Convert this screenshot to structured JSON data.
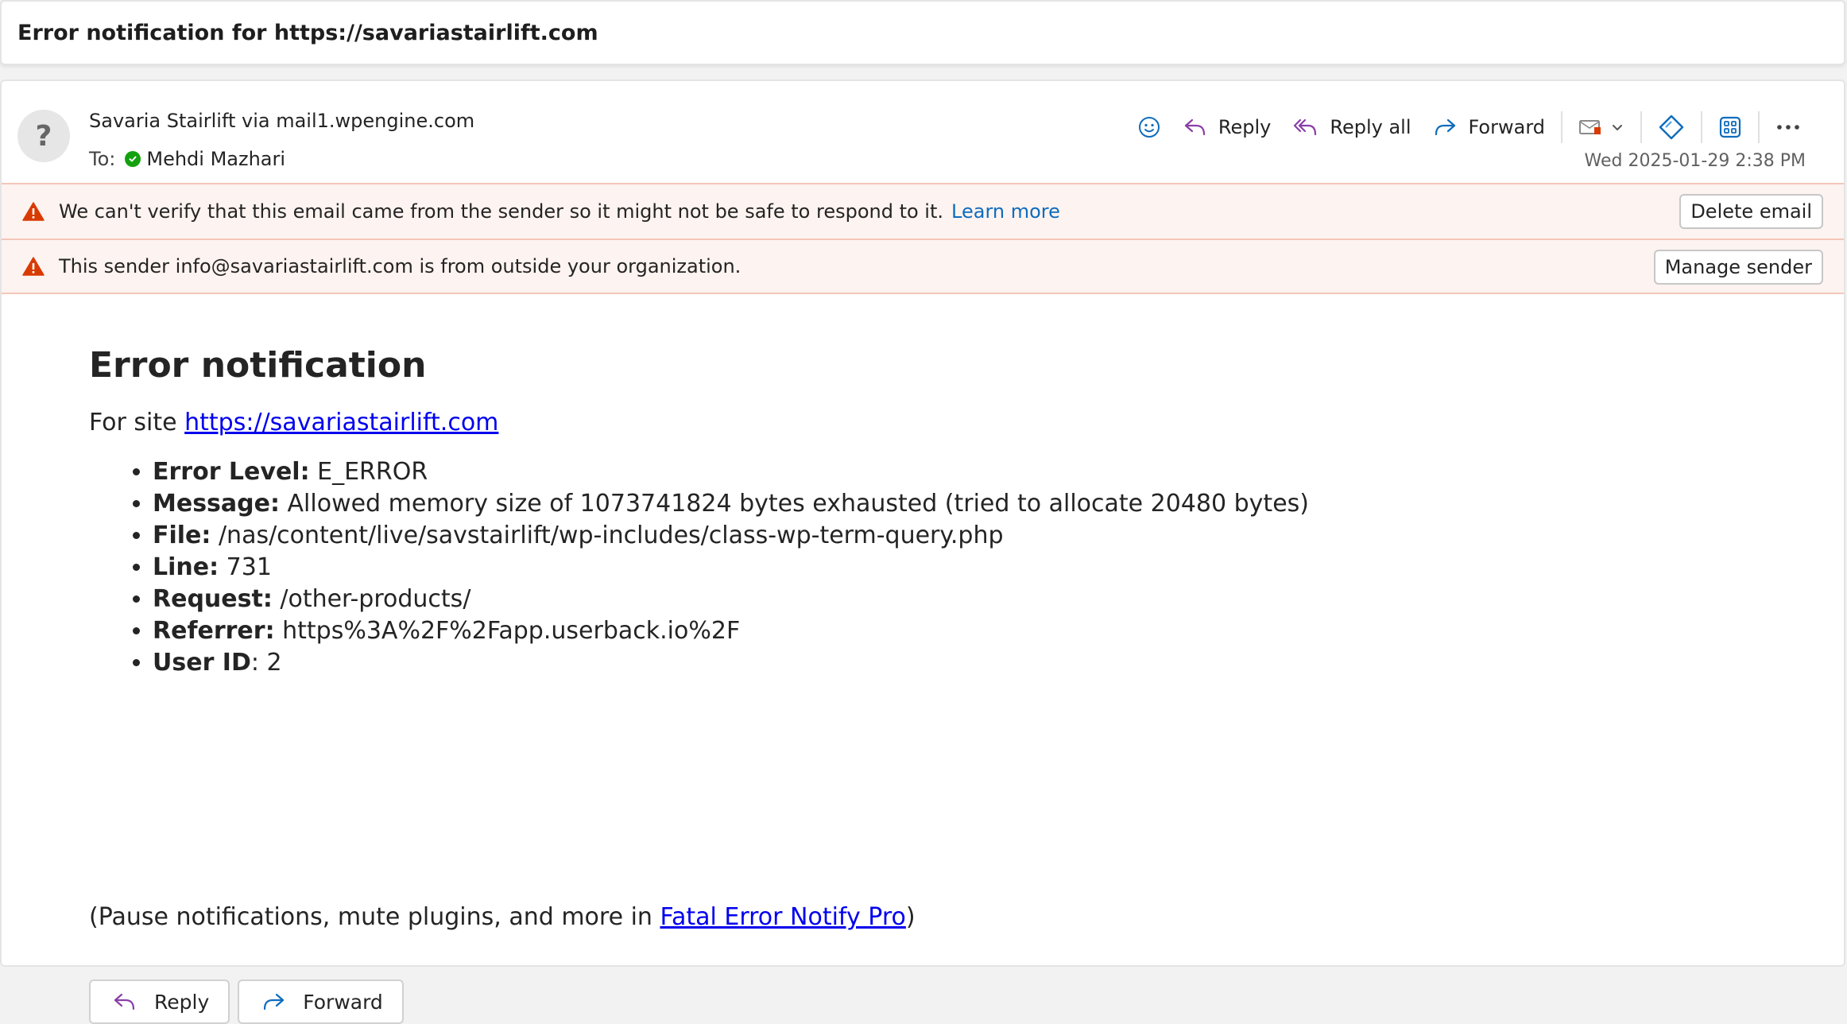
{
  "subject": "Error notification for https://savariastairlift.com",
  "header": {
    "sender": "Savaria Stairlift via mail1.wpengine.com",
    "to_label": "To:",
    "recipient": "Mehdi Mazhari",
    "date": "Wed 2025-01-29 2:38 PM",
    "avatar_glyph": "?"
  },
  "toolbar": {
    "reply_label": "Reply",
    "reply_all_label": "Reply all",
    "forward_label": "Forward"
  },
  "banners": {
    "verify_text": "We can't verify that this email came from the sender so it might not be safe to respond to it.",
    "learn_more": "Learn more",
    "delete_email": "Delete email",
    "external_text": "This sender info@savariastairlift.com is from outside your organization.",
    "manage_sender": "Manage sender"
  },
  "body": {
    "title": "Error notification",
    "for_site_prefix": "For site ",
    "site_link": "https://savariastairlift.com",
    "details": [
      {
        "label": "Error Level:",
        "value": " E_ERROR"
      },
      {
        "label": "Message:",
        "value": " Allowed memory size of 1073741824 bytes exhausted (tried to allocate 20480 bytes)"
      },
      {
        "label": "File:",
        "value": " /nas/content/live/savstairlift/wp-includes/class-wp-term-query.php"
      },
      {
        "label": "Line:",
        "value": " 731"
      },
      {
        "label": "Request:",
        "value": " /other-products/"
      },
      {
        "label": "Referrer:",
        "value": " https%3A%2F%2Fapp.userback.io%2F"
      },
      {
        "label": "User ID",
        "value": ": 2"
      }
    ],
    "footer_prefix": "(Pause notifications, mute plugins, and more in ",
    "footer_link": "Fatal Error Notify Pro",
    "footer_suffix": ")"
  },
  "bottom_actions": {
    "reply_label": "Reply",
    "forward_label": "Forward"
  },
  "colors": {
    "reply_icon": "#8a3fa8",
    "forward_icon": "#0f6cbd",
    "warning": "#d83b01",
    "presence": "#13a10e",
    "link": "#0000ee"
  }
}
